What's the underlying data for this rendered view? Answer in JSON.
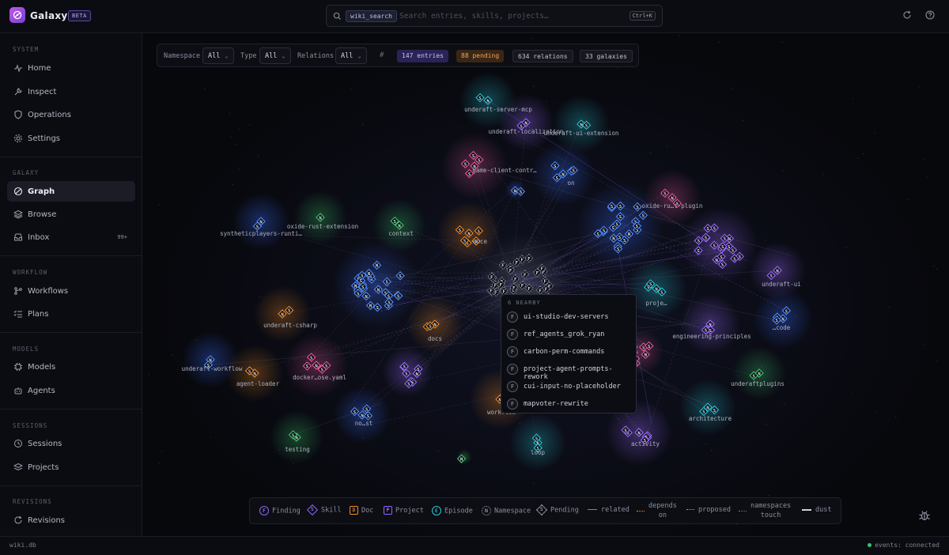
{
  "app": {
    "name": "Galaxy",
    "badge": "BETA"
  },
  "search": {
    "scope": "wiki_search",
    "placeholder": "Search entries, skills, projects…",
    "shortcut": "Ctrl+K"
  },
  "sidebar": {
    "sections": [
      {
        "title": "SYSTEM",
        "items": [
          {
            "label": "Home",
            "icon": "activity-icon"
          },
          {
            "label": "Inspect",
            "icon": "wrench-icon"
          },
          {
            "label": "Operations",
            "icon": "shield-icon"
          },
          {
            "label": "Settings",
            "icon": "gear-icon"
          }
        ]
      },
      {
        "title": "GALAXY",
        "items": [
          {
            "label": "Graph",
            "icon": "galaxy-icon",
            "active": true
          },
          {
            "label": "Browse",
            "icon": "layers-icon"
          },
          {
            "label": "Inbox",
            "icon": "inbox-icon",
            "count": "99+"
          }
        ]
      },
      {
        "title": "WORKFLOW",
        "items": [
          {
            "label": "Workflows",
            "icon": "workflow-icon"
          },
          {
            "label": "Plans",
            "icon": "checklist-icon"
          }
        ]
      },
      {
        "title": "MODELS",
        "items": [
          {
            "label": "Models",
            "icon": "chip-icon"
          },
          {
            "label": "Agents",
            "icon": "robot-icon"
          }
        ]
      },
      {
        "title": "SESSIONS",
        "items": [
          {
            "label": "Sessions",
            "icon": "history-icon"
          },
          {
            "label": "Projects",
            "icon": "stack-icon"
          }
        ]
      },
      {
        "title": "REVISIONS",
        "items": [
          {
            "label": "Revisions",
            "icon": "revisions-icon"
          }
        ]
      }
    ]
  },
  "filters": {
    "namespace_label": "Namespace",
    "namespace_value": "All",
    "type_label": "Type",
    "type_value": "All",
    "relations_label": "Relations",
    "relations_value": "All",
    "hash": "#",
    "entries": "147 entries",
    "pending": "88 pending",
    "relations": "634 relations",
    "galaxies": "33 galaxies"
  },
  "galaxies": [
    "underaft-server-mcp",
    "underaft-localization",
    "underaft-ui-extension",
    "game-client-contr…",
    "on",
    "oxide-ru…t-plugin",
    "syntheticplayers-runti…",
    "oxide-rust-extension",
    "context",
    "ence",
    "underaft-ui",
    "proje…",
    "underaft-csharp",
    "docs",
    "engineering-principles",
    "…code",
    "underaft-workflow",
    "agent-loader",
    "docker…ose.yaml",
    "underaftplugins",
    "workflow",
    "no…st",
    "architecture",
    "testing",
    "loop",
    "activity"
  ],
  "tooltip": {
    "header": "6 NEARBY",
    "items": [
      {
        "badge": "F",
        "label": "ui-studio-dev-servers"
      },
      {
        "badge": "F",
        "label": "ref_agents_grok_ryan"
      },
      {
        "badge": "F",
        "label": "carbon-perm-commands"
      },
      {
        "badge": "F",
        "label": "project-agent-prompts-rework"
      },
      {
        "badge": "F",
        "label": "cui-input-no-placeholder"
      },
      {
        "badge": "F",
        "label": "mapvoter-rewrite"
      }
    ]
  },
  "legend": {
    "finding": "Finding",
    "skill": "Skill",
    "doc": "Doc",
    "project": "Project",
    "episode": "Episode",
    "namespace": "Namespace",
    "pending": "Pending",
    "related": "related",
    "depends_on_1": "depends",
    "depends_on_2": "on",
    "proposed": "proposed",
    "ns_touch_1": "namespaces",
    "ns_touch_2": "touch",
    "dust": "dust"
  },
  "footer": {
    "db": "wiki.db",
    "status": "events: connected"
  },
  "colors": {
    "skill_blue": "#4f8cff",
    "skill_pink": "#e8589c",
    "doc_orange": "#f08a24",
    "namespace_purple": "#9b6bff",
    "cyan": "#28c8d8",
    "green": "#3cc86a",
    "pending_gray": "#8a8d9c",
    "accent": "#8f63ff"
  }
}
